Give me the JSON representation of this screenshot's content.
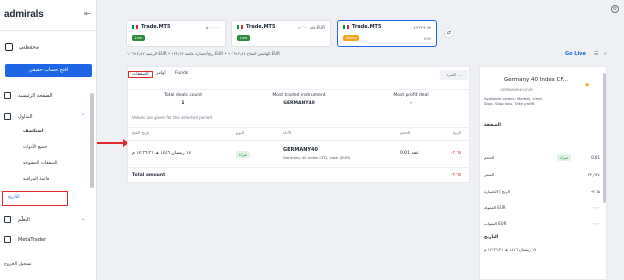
{
  "brand": {
    "logo": "admirals"
  },
  "sidebar": {
    "wallet_label": "محفظتي",
    "open_account_button": "افتح حساب حقيقي",
    "nav": [
      {
        "label": "الصفحة الرئيسية",
        "icon": "home-icon"
      },
      {
        "label": "التداول",
        "icon": "chart-icon"
      }
    ],
    "sub_items": [
      "استكشف",
      "جميع الأدوات",
      "الصفقات المفتوحة",
      "قائمة المراقبة"
    ],
    "history_label": "التاريخ",
    "nav2": [
      {
        "label": "التعلّم",
        "icon": "book-icon"
      },
      {
        "label": "MetaTrader",
        "icon": "terminal-icon"
      }
    ],
    "footer_link": "تسجيل الخروج"
  },
  "accounts": [
    {
      "name": "Trade.MT5",
      "balance": "٥٠٠٠.٠٠",
      "badge": "Live",
      "badge_color": "#2f8a3f",
      "sub": ""
    },
    {
      "name": "Trade.MT5",
      "balance": "١٠٬٠٠٠٫٥٥ EUR",
      "badge": "Live",
      "badge_color": "#2f8a3f",
      "sub": ""
    },
    {
      "name": "Trade.MT5",
      "balance": "٤٩٬٢٢٩.٩٧",
      "badge": "Demo",
      "badge_color": "#f2a21e",
      "sub": "EUR"
    }
  ],
  "infobar": "الرصيد ١٠٬٩١٢٫٤٢ EUR • ربح/خسارة عائمة ١٢٢٫٦٢ EUR • الهامش المتاح ١٠٬٩١٢٫٤٢ EUR",
  "toolbar": {
    "go_live": "Go Live",
    "filter_button": "الفترة ..."
  },
  "tabs": [
    "الصفقات",
    "أوامر",
    "Funds"
  ],
  "stats": [
    {
      "label": "Total deals count",
      "value": "1"
    },
    {
      "label": "Most traded instrument",
      "value": "GERMANY40"
    },
    {
      "label": "Most profit deal",
      "value": "-"
    }
  ],
  "note": "Values are given for the selected period",
  "table": {
    "headers": [
      "تاريخ الفتح",
      "النوع",
      "الأداة",
      "الحجم",
      "الربح"
    ],
    "row": {
      "date": "١٧ رمضان ١٤٤٦ هـ ١٢:٣٦:٣١ م",
      "type": "شراء",
      "symbol": "GERMANY40",
      "symbol_sub": "Germany 40 Index CFD, cash (EUR)",
      "volume": "0.01 عقد",
      "profit": "-٣.٦٥"
    },
    "total_label": "Total amount",
    "total_value": "-٣.٦٥"
  },
  "details": {
    "title": "Germany 40 Index CF...",
    "subtitle": "GERMANY40.EUR",
    "description": "Available orders: Market, Limit, Stop, Stop loss, Take profit",
    "section_deal": "الصفقة",
    "rows": [
      {
        "key": "الحجم",
        "value": "0.01",
        "tag": "شراء"
      },
      {
        "key": "السعر",
        "value": "٢٢٫٦٢٤"
      },
      {
        "key": "الربح / الخسارة",
        "value": "-٣.٦٥"
      },
      {
        "key": "العمولة EUR",
        "value": "٠.٠٠"
      },
      {
        "key": "السواب EUR",
        "value": "٠.٠٠"
      }
    ],
    "section_dates": "التاريخ",
    "date_value": "١٧ رمضان ١٤٤٦ هـ ١٢:٣٦:٣١ م"
  }
}
